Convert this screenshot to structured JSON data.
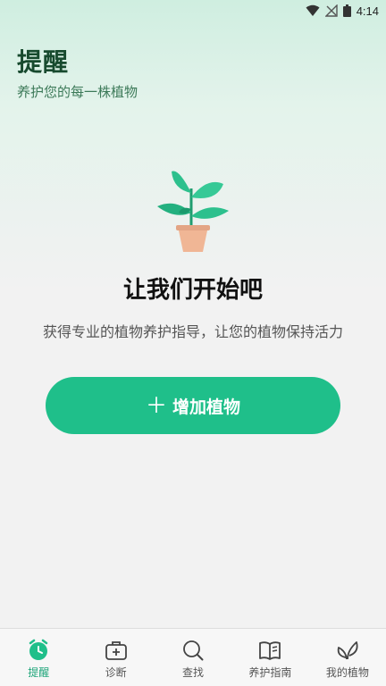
{
  "status_bar": {
    "time": "4:14"
  },
  "header": {
    "title": "提醒",
    "subtitle": "养护您的每一株植物"
  },
  "empty_state": {
    "illustration": "potted-plant-illustration",
    "title": "让我们开始吧",
    "description": "获得专业的植物养护指导，让您的植物保持活力"
  },
  "add_button": {
    "icon": "plus-icon",
    "label": "增加植物"
  },
  "bottom_nav": {
    "items": [
      {
        "label": "提醒",
        "icon": "alarm-clock-icon",
        "active": true
      },
      {
        "label": "诊断",
        "icon": "medical-kit-icon",
        "active": false
      },
      {
        "label": "查找",
        "icon": "search-icon",
        "active": false
      },
      {
        "label": "养护指南",
        "icon": "book-icon",
        "active": false
      },
      {
        "label": "我的植物",
        "icon": "leaf-icon",
        "active": false
      }
    ]
  },
  "colors": {
    "accent": "#1fbf8a",
    "title": "#174a2e",
    "subtitle": "#3d7a59",
    "active_nav": "#1fa57a"
  }
}
